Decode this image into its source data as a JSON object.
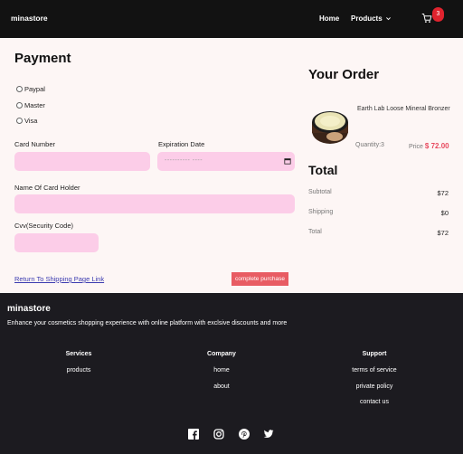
{
  "nav": {
    "brand": "minastore",
    "home": "Home",
    "products": "Products",
    "cart_count": "3"
  },
  "payment": {
    "title": "Payment",
    "methods": [
      "Paypal",
      "Master",
      "Visa"
    ],
    "card_number_label": "Card Number",
    "expiration_label": "Expiration Date",
    "expiration_placeholder": "---------- ----",
    "holder_label": "Name Of Card Holder",
    "cvv_label": "Cvv(Security Code)",
    "back_link": "Return To Shipping Page Link",
    "complete_button": "complete purchase"
  },
  "order": {
    "title": "Your Order",
    "product_name": "Earth Lab Loose Mineral Bronzer",
    "quantity": "Quantity:3",
    "price_label": "Price",
    "price_value": "$ 72.00",
    "total_title": "Total",
    "subtotal_label": "Subtotal",
    "subtotal_value": "$72",
    "shipping_label": "Shipping",
    "shipping_value": "$0",
    "total_label": "Total",
    "total_value": "$72"
  },
  "footer": {
    "brand": "minastore",
    "tagline": "Enhance your cosmetics shopping experience with online platform with exclsive discounts and more",
    "services_title": "Services",
    "services_links": [
      "products"
    ],
    "company_title": "Company",
    "company_links": [
      "home",
      "about"
    ],
    "support_title": "Support",
    "support_links": [
      "terms of service",
      "private policy",
      "contact us"
    ],
    "social_icons": [
      "facebook-icon",
      "instagram-icon",
      "pinterest-icon",
      "twitter-icon"
    ]
  },
  "colors": {
    "nav_bg": "#121212",
    "footer_bg": "#1c1b20",
    "field_pink": "#fccde8",
    "accent_red": "#e84a5f",
    "button_red": "#e85c63"
  }
}
